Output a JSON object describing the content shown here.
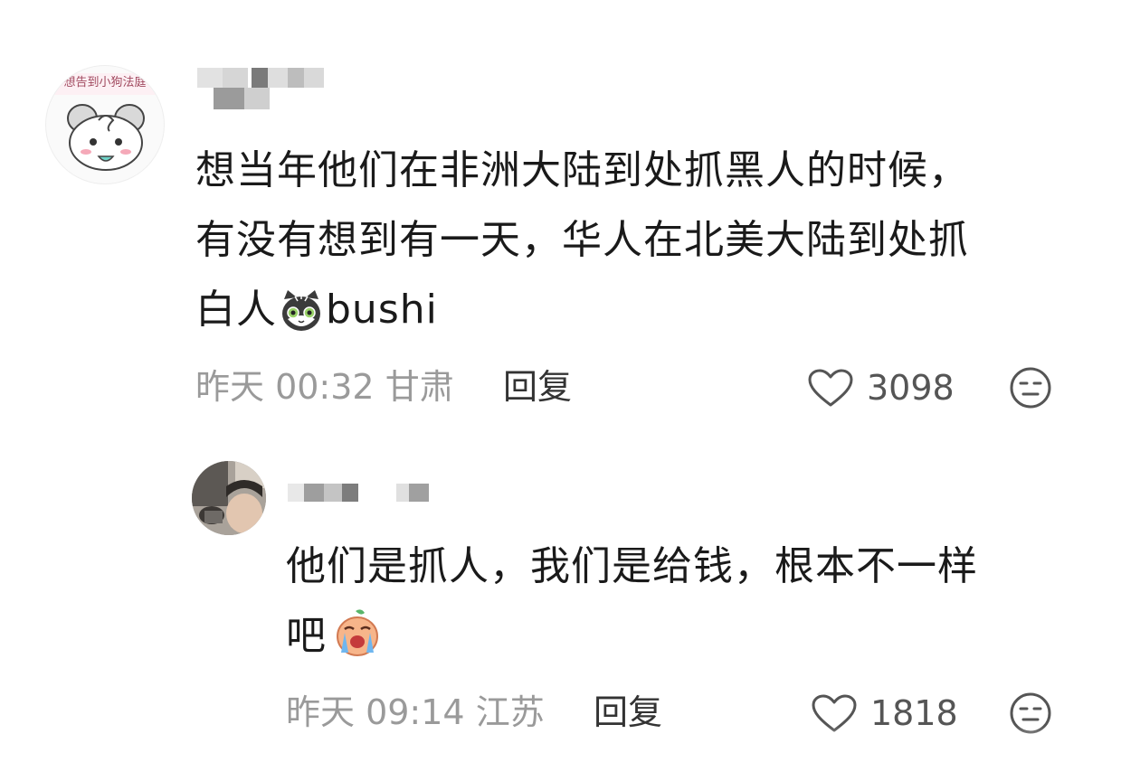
{
  "comments": [
    {
      "text_lines": [
        "想当年他们在非洲大陆到处抓黑人的时候，",
        "有没有想到有一天，华人在北美大陆到处抓",
        "白人"
      ],
      "text_suffix": "bushi",
      "time": "昨天 00:32",
      "location": "甘肃",
      "reply_label": "回复",
      "likes": "3098",
      "emoji": "cat-emoji",
      "avatar_caption": "想告到小狗法庭"
    },
    {
      "text_lines": [
        "他们是抓人，我们是给钱，根本不一样",
        "吧"
      ],
      "time": "昨天 09:14",
      "location": "江苏",
      "reply_label": "回复",
      "likes": "1818",
      "emoji": "crying-emoji"
    }
  ],
  "colors": {
    "text": "#1a1a1a",
    "meta": "#9a9a9a",
    "icon": "#555555"
  }
}
